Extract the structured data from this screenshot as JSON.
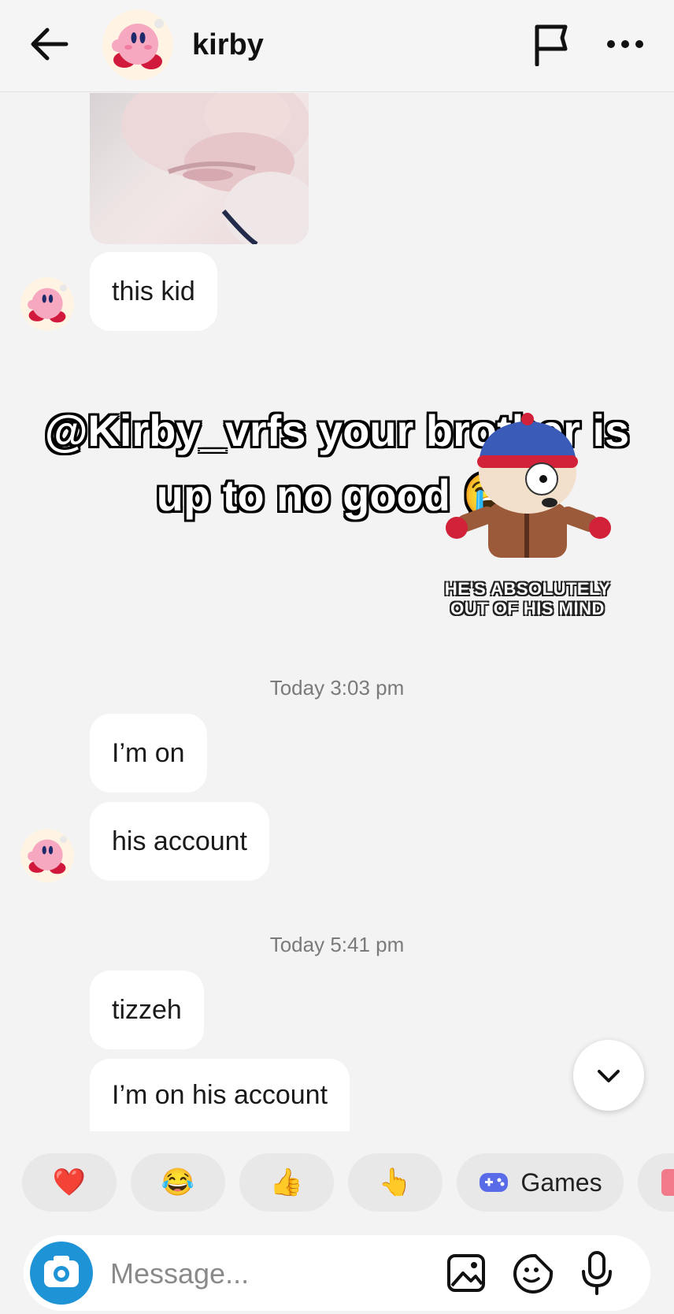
{
  "header": {
    "title": "kirby"
  },
  "messages": [
    {
      "text": "this kid"
    },
    {
      "text": "I’m on"
    },
    {
      "text": "his account"
    },
    {
      "text": "tizzeh"
    },
    {
      "text": "I’m on his account"
    }
  ],
  "timestamps": [
    "Today 3:03 pm",
    "Today 5:41 pm"
  ],
  "overlay": {
    "caption_line1": "@Kirby_vrfs your brother is",
    "caption_line2": "up to no good 😭",
    "sticker_line1": "HE'S ABSOLUTELY",
    "sticker_line2": "OUT OF HIS MIND"
  },
  "quick_replies": [
    "❤️",
    "😂",
    "👍",
    "👆",
    "Games"
  ],
  "composer": {
    "placeholder": "Message..."
  },
  "colors": {
    "background": "#f3f3f3",
    "bubble": "#ffffff",
    "camera": "#1e93d6"
  }
}
